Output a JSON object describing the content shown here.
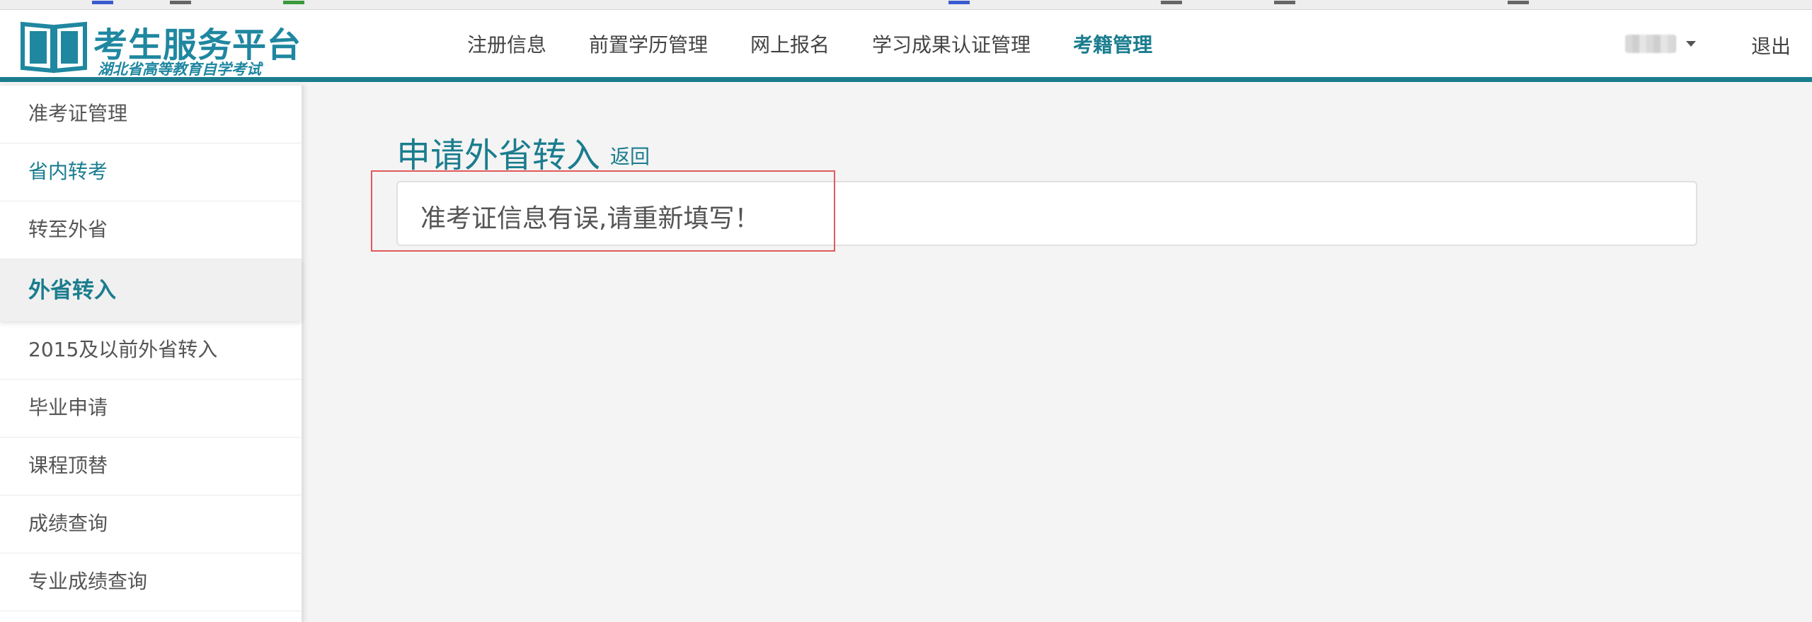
{
  "header": {
    "logo_title": "考生服务平台",
    "logo_subtitle": "湖北省高等教育自学考试",
    "nav": [
      {
        "label": "注册信息"
      },
      {
        "label": "前置学历管理"
      },
      {
        "label": "网上报名"
      },
      {
        "label": "学习成果认证管理"
      },
      {
        "label": "考籍管理",
        "active": true
      }
    ],
    "logout_label": "退出",
    "accent_color": "#1a7d8e"
  },
  "sidebar": {
    "items": [
      {
        "label": "准考证管理"
      },
      {
        "label": "省内转考"
      },
      {
        "label": "转至外省"
      },
      {
        "label": "外省转入"
      },
      {
        "label": "2015及以前外省转入"
      },
      {
        "label": "毕业申请"
      },
      {
        "label": "课程顶替"
      },
      {
        "label": "成绩查询"
      },
      {
        "label": "专业成绩查询"
      }
    ]
  },
  "main": {
    "title": "申请外省转入",
    "back_label": "返回",
    "alert_message": "准考证信息有误,请重新填写！"
  }
}
